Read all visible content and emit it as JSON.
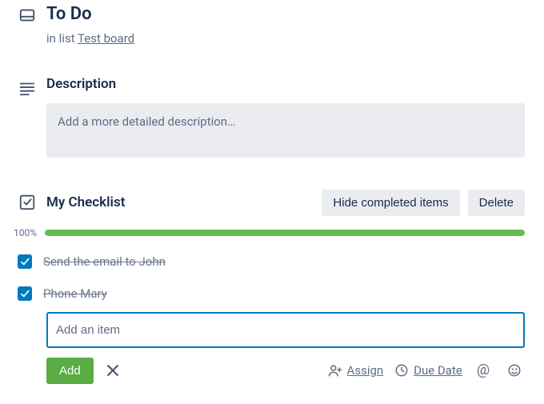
{
  "card": {
    "title": "To Do",
    "sub_prefix": "in list ",
    "list_name": "Test board"
  },
  "description": {
    "heading": "Description",
    "placeholder": "Add a more detailed description…"
  },
  "checklist": {
    "heading": "My Checklist",
    "hide_label": "Hide completed items",
    "delete_label": "Delete",
    "progress_percent": "100%",
    "progress_value": 100,
    "items": [
      {
        "text": "Send the email to John",
        "checked": true
      },
      {
        "text": "Phone Mary",
        "checked": true
      }
    ],
    "add_placeholder": "Add an item",
    "add_button": "Add",
    "assign_label": "Assign",
    "due_label": "Due Date"
  }
}
